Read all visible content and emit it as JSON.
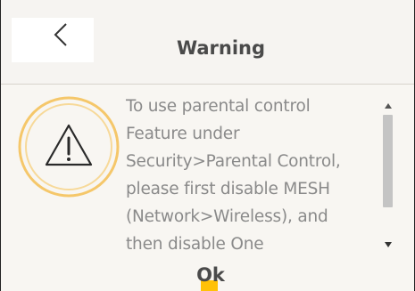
{
  "dialog": {
    "title": "Warning",
    "back_icon": "chevron-left-icon",
    "warning_icon": "warning-triangle-icon",
    "message_lines": [
      "To use parental control",
      "Feature under",
      "Security>Parental Control,",
      "please first disable MESH",
      "(Network>Wireless), and",
      "then disable One"
    ],
    "ok_label": "Ok"
  },
  "colors": {
    "accent": "#ffc107",
    "icon_ring": "#f5c76a",
    "title_text": "#4a4a4a",
    "message_text": "#8a8a8a",
    "background": "#f8f6f2"
  }
}
